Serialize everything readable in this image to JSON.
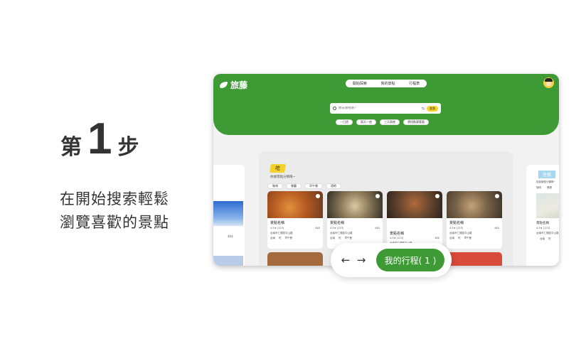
{
  "step": {
    "prefix": "第",
    "number": "1",
    "suffix": "步"
  },
  "description": [
    "在開始搜索輕鬆",
    "瀏覽喜歡的景點"
  ],
  "app": {
    "brand": "旅藤",
    "nav": [
      "開始探索",
      "我的景點",
      "行程表"
    ],
    "search": {
      "placeholder": "想去哪裡呢?",
      "button": "查詢"
    },
    "quick_chips": [
      "一日遊",
      "兩天一夜",
      "三天兩夜",
      "想找點樂看看"
    ],
    "category": {
      "tag": "吃",
      "subtitle": "依據景點分類唷~",
      "filters": [
        "咖啡",
        "餐廳",
        "早午餐",
        "酒吧"
      ]
    },
    "cards": [
      {
        "name": "景點名稱",
        "rating": "4.5★ (123)",
        "price": "$$$",
        "address": "台南市仁德區中山路",
        "tags": [
          "台南",
          "吃",
          "早午餐"
        ]
      },
      {
        "name": "景點名稱",
        "rating": "4.5★ (123)",
        "price": "$$$",
        "address": "台南市仁德區中山路",
        "tags": [
          "台南",
          "吃",
          "早午餐"
        ]
      },
      {
        "name": "景點名稱",
        "rating": "4.5★ (123)",
        "price": "$$$",
        "address": "台南市仁德區中山路",
        "tags": [
          "台南",
          "吃",
          "早午餐"
        ]
      },
      {
        "name": "景點名稱",
        "rating": "4.5★ (123)",
        "price": "$$$",
        "address": "台南市仁德區中山路",
        "tags": [
          "台南",
          "吃",
          "早午餐"
        ]
      }
    ],
    "right_panel": {
      "tag": "住宿",
      "subtitle": "依據景點分類唷~",
      "chips": [
        "咖啡",
        "餐廳"
      ],
      "card": {
        "name": "景點名稱",
        "rating": "4.5★ (123)",
        "address": "台南市仁德區中山路",
        "tags": [
          "台南",
          "吃"
        ]
      }
    },
    "left_panel": {
      "price": "$$$"
    }
  },
  "bottom": {
    "trip_label": "我的行程( 1 )"
  },
  "colors": {
    "brand_green": "#3e9a34",
    "accent_yellow": "#f5d22a"
  }
}
